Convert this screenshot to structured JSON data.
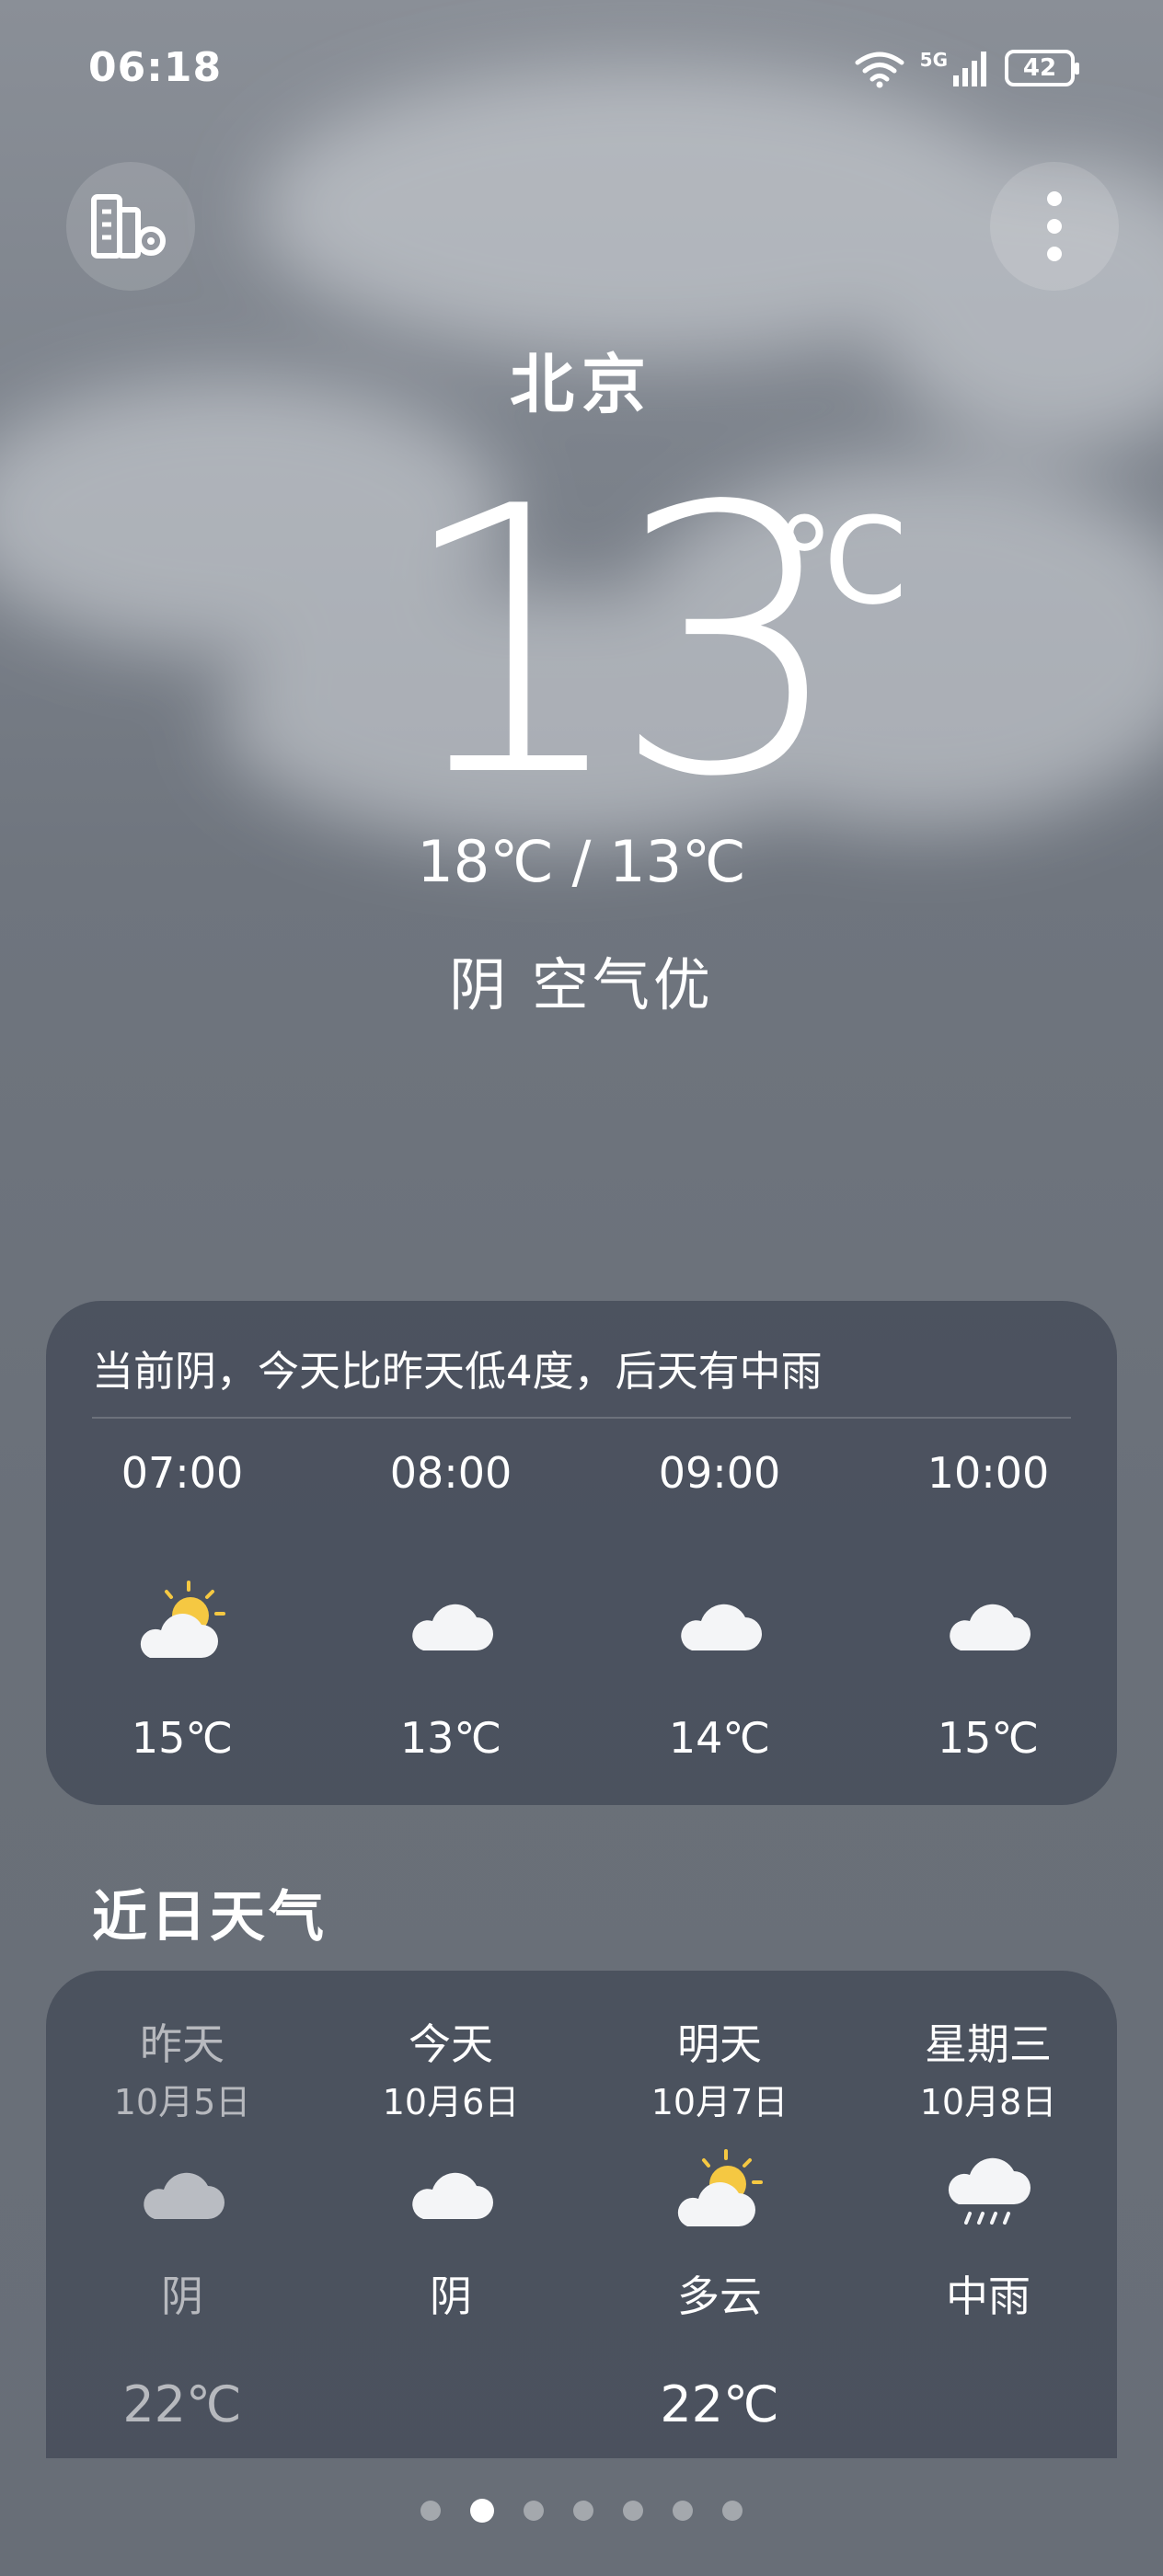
{
  "status": {
    "time": "06:18",
    "network": "5G",
    "battery": "42"
  },
  "location": "北京",
  "current": {
    "temp": "13",
    "unit": "℃",
    "range": "18℃ / 13℃",
    "condition": "阴  空气优"
  },
  "hourly": {
    "summary": "当前阴，今天比昨天低4度，后天有中雨",
    "items": [
      {
        "time": "07:00",
        "icon": "partly-cloudy-icon",
        "temp": "15℃"
      },
      {
        "time": "08:00",
        "icon": "cloud-icon",
        "temp": "13℃"
      },
      {
        "time": "09:00",
        "icon": "cloud-icon",
        "temp": "14℃"
      },
      {
        "time": "10:00",
        "icon": "cloud-icon",
        "temp": "15℃"
      }
    ]
  },
  "daily": {
    "title": "近日天气",
    "items": [
      {
        "label": "昨天",
        "date": "10月5日",
        "icon": "cloud-icon",
        "condition": "阴",
        "high": "22℃"
      },
      {
        "label": "今天",
        "date": "10月6日",
        "icon": "cloud-icon",
        "condition": "阴",
        "high": ""
      },
      {
        "label": "明天",
        "date": "10月7日",
        "icon": "partly-cloudy-icon",
        "condition": "多云",
        "high": "22℃"
      },
      {
        "label": "星期三",
        "date": "10月8日",
        "icon": "rain-icon",
        "condition": "中雨",
        "high": ""
      }
    ]
  },
  "pager": {
    "count": 7,
    "active": 1
  },
  "colors": {
    "sun": "#f5c842",
    "card": "#404654",
    "cloud": "#ffffff"
  }
}
